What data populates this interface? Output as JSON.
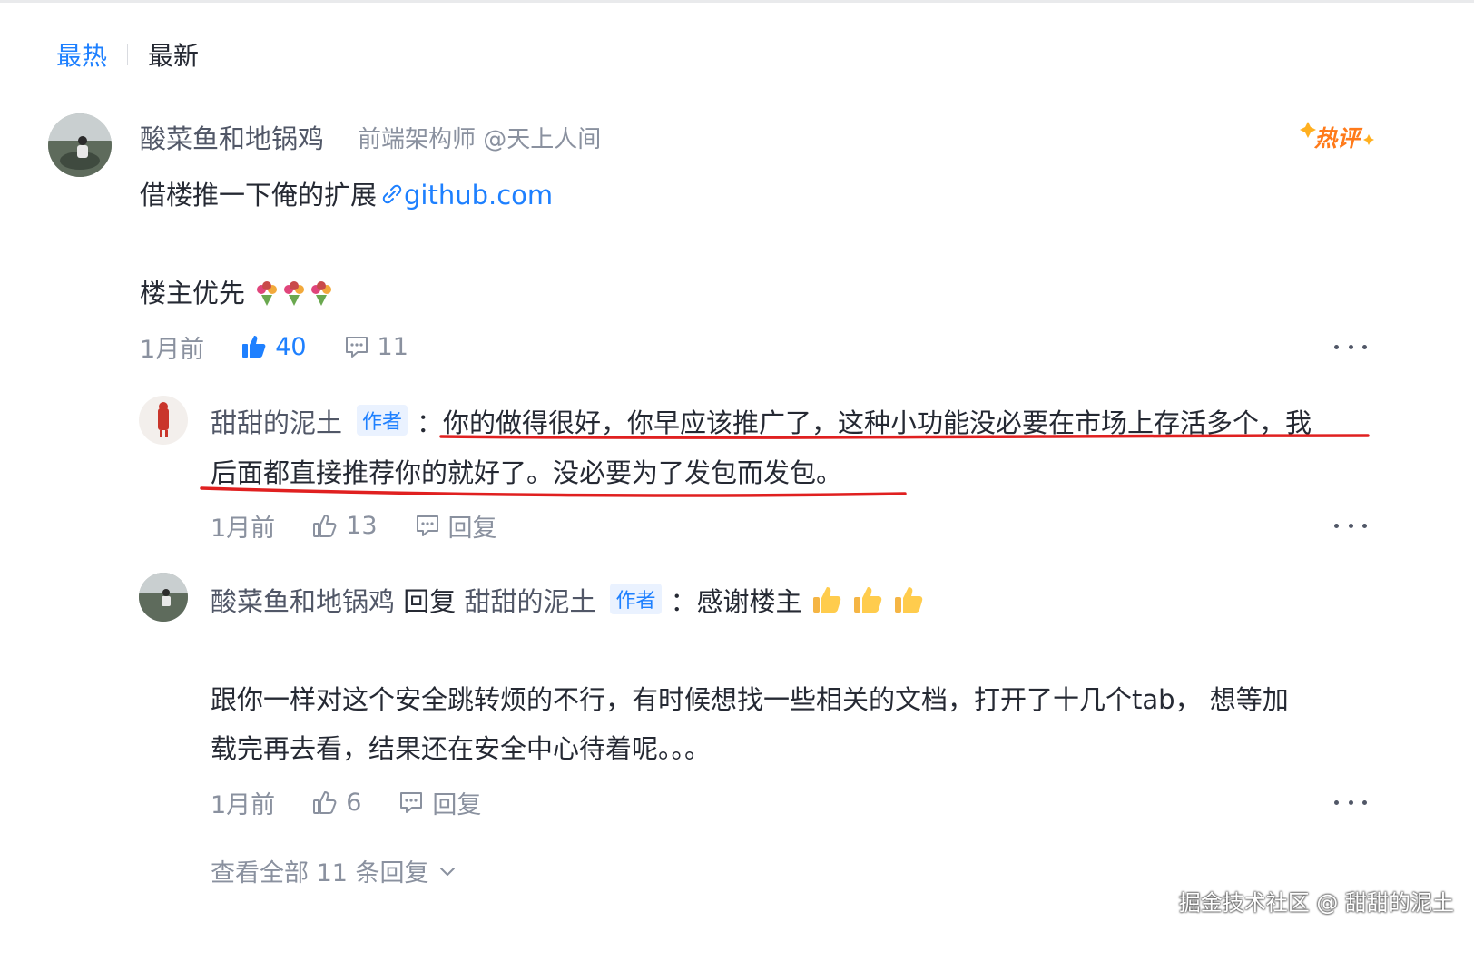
{
  "tabs": {
    "hot": "最热",
    "new": "最新"
  },
  "comment": {
    "author": "酸菜鱼和地锅鸡",
    "job": "前端架构师 @天上人间",
    "badge": "热评",
    "line1_text": "借楼推一下俺的扩展",
    "link_text": "github.com",
    "line2_text": "楼主优先",
    "time": "1月前",
    "likes": "40",
    "replies_count": "11"
  },
  "reply1": {
    "author": "甜甜的泥土",
    "tag": "作者",
    "colon": "：",
    "line1": "你的做得很好，你早应该推广了，这种小功能没必要在市场上存活多个，我",
    "line2": "后面都直接推荐你的就好了。没必要为了发包而发包。",
    "time": "1月前",
    "likes": "13",
    "reply_label": "回复"
  },
  "reply2": {
    "author": "酸菜鱼和地锅鸡",
    "reply_word": "回复",
    "target": "甜甜的泥土",
    "tag": "作者",
    "colon": "：",
    "line1": "感谢楼主",
    "line2": "跟你一样对这个安全跳转烦的不行，有时候想找一些相关的文档，打开了十几个tab，  想等加",
    "line3": "载完再去看，结果还在安全中心待着呢。。。",
    "time": "1月前",
    "likes": "6",
    "reply_label": "回复"
  },
  "view_all": "查看全部 11 条回复",
  "watermark": "掘金技术社区 @ 甜甜的泥土",
  "colors": {
    "accent": "#1e80ff",
    "underline": "#e02020",
    "hot_badge": "#ff7a1a"
  }
}
